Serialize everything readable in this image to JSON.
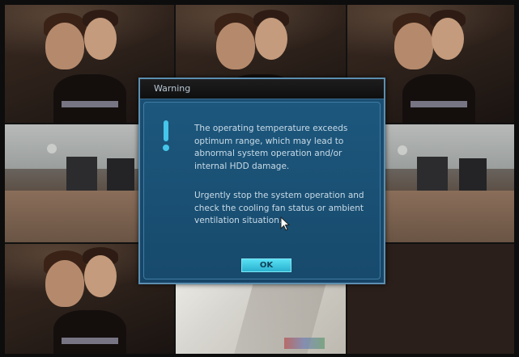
{
  "dialog": {
    "title": "Warning",
    "icon": "exclamation-icon",
    "message_paragraph_1": "The operating temperature exceeds optimum range, which may lead to abnormal system operation and/or internal HDD damage.",
    "message_paragraph_2": "Urgently stop the system operation and check the cooling fan status or ambient ventilation situation.",
    "ok_label": "OK"
  },
  "camera_grid": {
    "rows": 3,
    "cols": 3,
    "tiles": [
      {
        "id": "cam-1",
        "scene": "person"
      },
      {
        "id": "cam-2",
        "scene": "person"
      },
      {
        "id": "cam-3",
        "scene": "person"
      },
      {
        "id": "cam-4",
        "scene": "office"
      },
      {
        "id": "cam-5",
        "scene": "office"
      },
      {
        "id": "cam-6",
        "scene": "office"
      },
      {
        "id": "cam-7",
        "scene": "person"
      },
      {
        "id": "cam-8",
        "scene": "corridor"
      },
      {
        "id": "cam-9",
        "scene": "empty"
      }
    ]
  },
  "colors": {
    "dialog_background": "#1b4f73",
    "dialog_border": "#5b8fb0",
    "accent": "#45c6ea",
    "message_text": "#c9dbe7",
    "ok_button": "#2bb1cf"
  }
}
